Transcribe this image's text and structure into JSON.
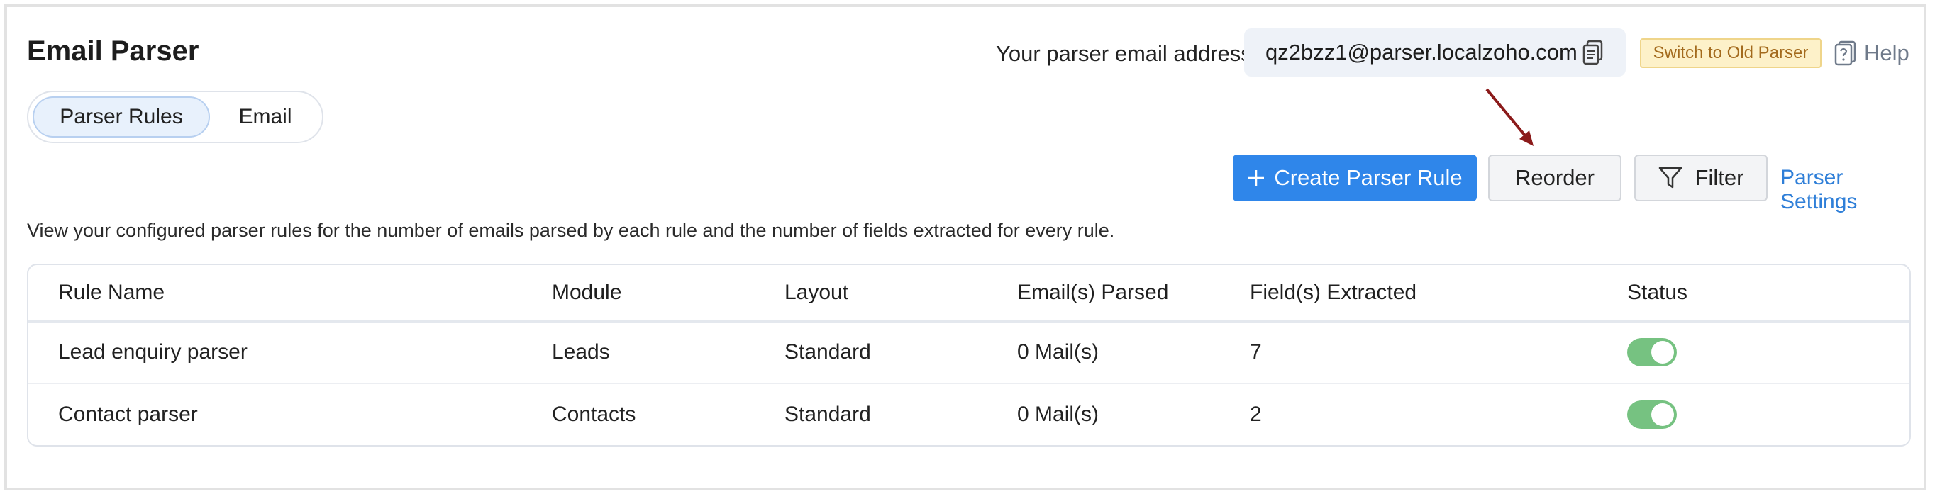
{
  "header": {
    "title": "Email Parser",
    "email_label": "Your parser email address",
    "email_address": "qz2bzz1@parser.localzoho.com",
    "switch_label": "Switch to Old Parser",
    "help_label": "Help"
  },
  "tabs": [
    {
      "label": "Parser Rules",
      "active": true
    },
    {
      "label": "Email",
      "active": false
    }
  ],
  "toolbar": {
    "create_label": "Create Parser Rule",
    "reorder_label": "Reorder",
    "filter_label": "Filter",
    "settings_label": "Parser Settings"
  },
  "description": "View your configured parser rules for the number of emails parsed by each rule and the number of fields extracted for every rule.",
  "table": {
    "columns": [
      "Rule Name",
      "Module",
      "Layout",
      "Email(s) Parsed",
      "Field(s) Extracted",
      "Status"
    ],
    "rows": [
      {
        "rule_name": "Lead enquiry parser",
        "module": "Leads",
        "layout": "Standard",
        "emails_parsed": "0 Mail(s)",
        "fields_extracted": "7",
        "status_on": true
      },
      {
        "rule_name": "Contact parser",
        "module": "Contacts",
        "layout": "Standard",
        "emails_parsed": "0 Mail(s)",
        "fields_extracted": "2",
        "status_on": true
      }
    ]
  },
  "colors": {
    "accent": "#2f86ea",
    "link": "#2f7fd8",
    "toggle_on": "#76c281",
    "switch_bg": "#fdf1c9",
    "switch_text": "#a36a1d",
    "annotation_arrow": "#8b1a1a"
  },
  "icons": {
    "copy": "copy-icon",
    "help": "help-icon",
    "plus": "plus-icon",
    "filter": "filter-icon"
  }
}
